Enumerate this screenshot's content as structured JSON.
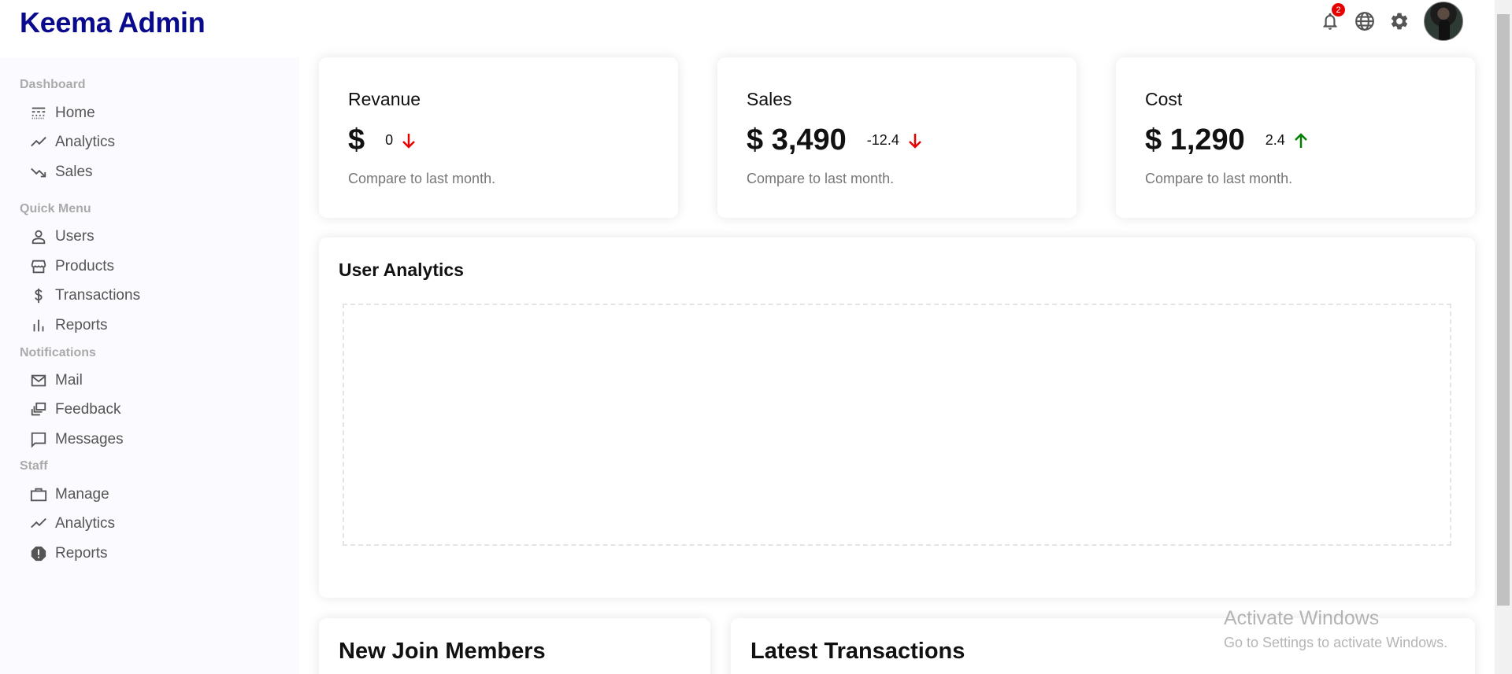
{
  "app": {
    "title": "Keema Admin"
  },
  "topbar": {
    "notification_count": "2"
  },
  "sidebar": {
    "sections": [
      {
        "title": "Dashboard",
        "items": [
          {
            "label": "Home",
            "icon": "line-style-icon"
          },
          {
            "label": "Analytics",
            "icon": "trending-up-icon"
          },
          {
            "label": "Sales",
            "icon": "trending-down-icon"
          }
        ]
      },
      {
        "title": "Quick Menu",
        "items": [
          {
            "label": "Users",
            "icon": "person-icon"
          },
          {
            "label": "Products",
            "icon": "storefront-icon"
          },
          {
            "label": "Transactions",
            "icon": "dollar-icon"
          },
          {
            "label": "Reports",
            "icon": "bar-chart-icon"
          }
        ]
      },
      {
        "title": "Notifications",
        "items": [
          {
            "label": "Mail",
            "icon": "mail-icon"
          },
          {
            "label": "Feedback",
            "icon": "dynamic-feed-icon"
          },
          {
            "label": "Messages",
            "icon": "chat-bubble-icon"
          }
        ]
      },
      {
        "title": "Staff",
        "items": [
          {
            "label": "Manage",
            "icon": "work-icon"
          },
          {
            "label": "Analytics",
            "icon": "timeline-icon"
          },
          {
            "label": "Reports",
            "icon": "report-icon"
          }
        ]
      }
    ]
  },
  "featured": [
    {
      "title": "Revanue",
      "money": "$",
      "rate": "0",
      "trend": "down",
      "sub": "Compare to last month."
    },
    {
      "title": "Sales",
      "money": "$ 3,490",
      "rate": "-12.4",
      "trend": "down",
      "sub": "Compare to last month."
    },
    {
      "title": "Cost",
      "money": "$ 1,290",
      "rate": "2.4",
      "trend": "up",
      "sub": "Compare to last month."
    }
  ],
  "chart": {
    "title": "User Analytics"
  },
  "widgets": {
    "members_title": "New Join Members",
    "transactions_title": "Latest Transactions"
  },
  "watermark": {
    "line1": "Activate Windows",
    "line2": "Go to Settings to activate Windows."
  },
  "colors": {
    "brand": "#0a0a8c",
    "down": "#e60000",
    "up": "#008000",
    "sidebar_bg": "#fbfbff"
  }
}
